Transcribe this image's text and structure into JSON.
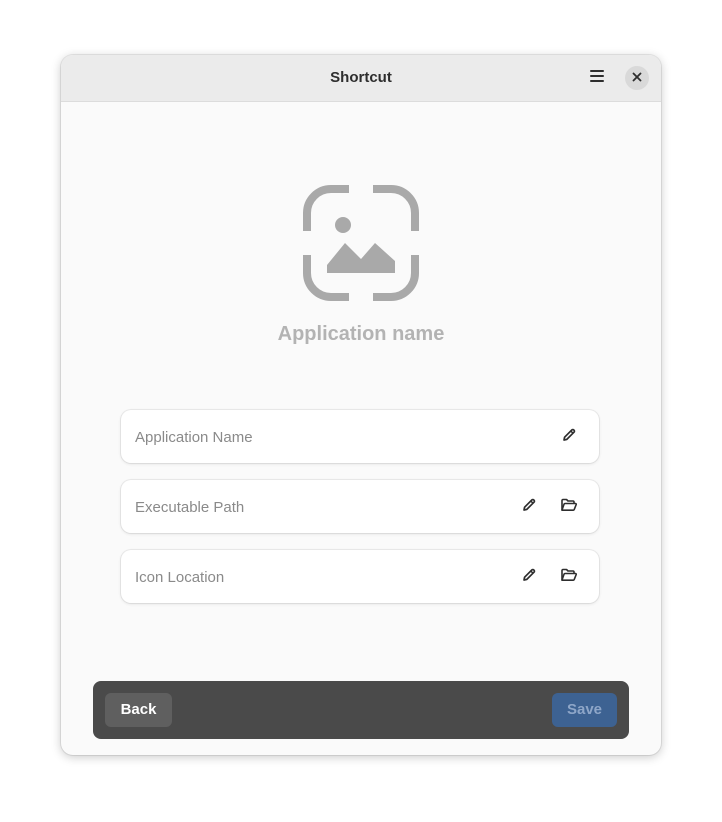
{
  "window": {
    "title": "Shortcut"
  },
  "header": {
    "menu_icon": "hamburger-menu-icon",
    "close_icon": "close-icon"
  },
  "preview": {
    "icon": "image-placeholder-icon",
    "name": "Application name"
  },
  "fields": [
    {
      "label": "Application Name",
      "buttons": [
        "edit-icon"
      ]
    },
    {
      "label": "Executable Path",
      "buttons": [
        "edit-icon",
        "folder-open-icon"
      ]
    },
    {
      "label": "Icon Location",
      "buttons": [
        "edit-icon",
        "folder-open-icon"
      ]
    }
  ],
  "footer": {
    "back_label": "Back",
    "save_label": "Save"
  },
  "colors": {
    "window_bg": "#fafafa",
    "headerbar_bg": "#ebebeb",
    "footer_bg": "#4a4a4a",
    "back_button_bg": "#5f5f5f",
    "save_button_bg": "#3d6292",
    "save_text": "#8ea6c8",
    "placeholder_text": "#8a8a8a",
    "app_name_text": "#b3b3b3"
  }
}
